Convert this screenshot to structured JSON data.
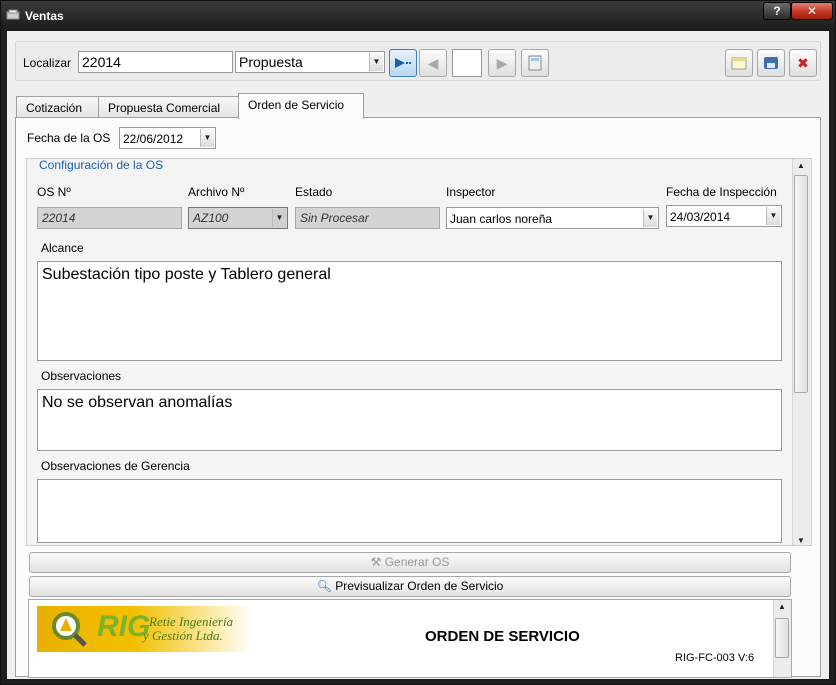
{
  "window": {
    "title": "Ventas",
    "help_label": "?",
    "close_label": "✕"
  },
  "toolbar": {
    "localizar_label": "Localizar",
    "localizar_value": "22014",
    "type_value": "Propuesta",
    "page_value": ""
  },
  "tabs": [
    {
      "label": "Cotización"
    },
    {
      "label": "Propuesta Comercial"
    },
    {
      "label": "Orden de Servicio"
    }
  ],
  "form": {
    "fecha_os_label": "Fecha de la OS",
    "fecha_os_value": "22/06/2012",
    "group_title": "Configuración de la OS",
    "os_label": "OS Nº",
    "os_value": "22014",
    "archivo_label": "Archivo Nº",
    "archivo_value": "AZ100",
    "estado_label": "Estado",
    "estado_value": "Sin Procesar",
    "inspector_label": "Inspector",
    "inspector_value": "Juan carlos noreña",
    "fecha_insp_label": "Fecha de Inspección",
    "fecha_insp_value": "24/03/2014",
    "alcance_label": "Alcance",
    "alcance_value": "Subestación tipo poste y Tablero general",
    "obs_label": "Observaciones",
    "obs_value": "No se observan anomalías",
    "obs_ger_label": "Observaciones de Gerencia",
    "obs_ger_value": ""
  },
  "buttons": {
    "generar_label": "Generar OS",
    "preview_label": "Previsualizar Orden de Servicio"
  },
  "preview": {
    "logo_short": "RIG",
    "logo_line1": "Retie Ingeniería",
    "logo_line2": "y Gestión Ltda.",
    "doc_title": "ORDEN DE SERVICIO",
    "doc_code": "RIG-FC-003 V:6"
  }
}
